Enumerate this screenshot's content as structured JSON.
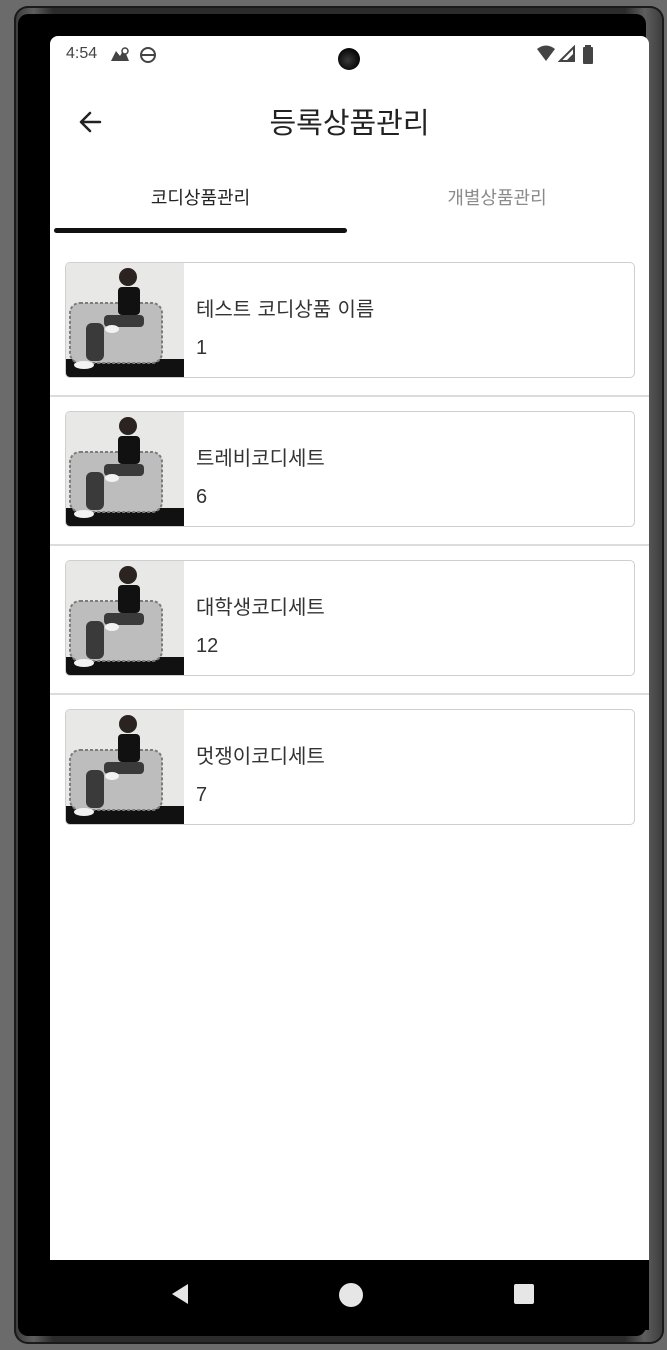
{
  "status_bar": {
    "time": "4:54",
    "left_icons": [
      "network-alert-icon",
      "sync-icon"
    ],
    "right_icons": [
      "wifi-icon",
      "cellular-icon",
      "battery-icon"
    ]
  },
  "header": {
    "title": "등록상품관리",
    "back_icon": "arrow-left-icon"
  },
  "tabs": [
    {
      "label": "코디상품관리",
      "active": true
    },
    {
      "label": "개별상품관리",
      "active": false
    }
  ],
  "items": [
    {
      "name": "테스트 코디상품 이름",
      "count": "1"
    },
    {
      "name": "트레비코디세트",
      "count": "6"
    },
    {
      "name": "대학생코디세트",
      "count": "12"
    },
    {
      "name": "멋쟁이코디세트",
      "count": "7"
    }
  ],
  "nav_bar": {
    "buttons": [
      "back-triangle-icon",
      "home-circle-icon",
      "recents-square-icon"
    ]
  },
  "colors": {
    "tab_indicator": "#111111",
    "tab_inactive_text": "#8a8a8a",
    "card_border": "#cfcfcf"
  }
}
